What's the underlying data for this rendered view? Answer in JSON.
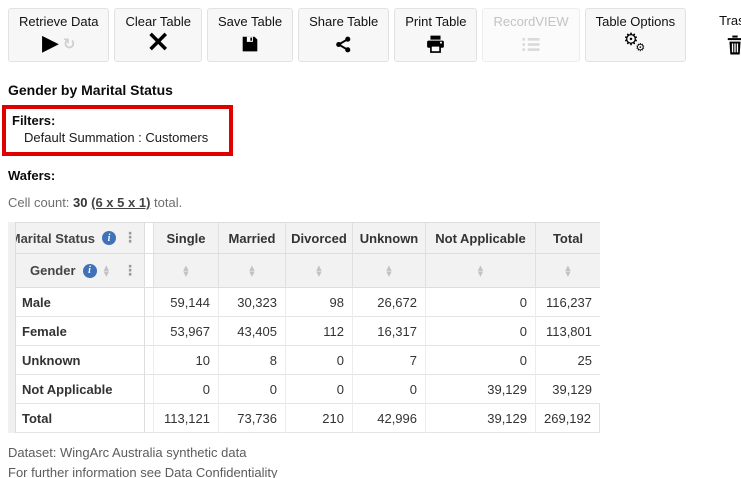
{
  "toolbar": {
    "buttons": [
      {
        "label": "Retrieve Data",
        "icon": "play-refresh-icon",
        "disabled": false
      },
      {
        "label": "Clear Table",
        "icon": "x-icon",
        "disabled": false
      },
      {
        "label": "Save Table",
        "icon": "floppy-icon",
        "disabled": false
      },
      {
        "label": "Share Table",
        "icon": "share-icon",
        "disabled": false
      },
      {
        "label": "Print Table",
        "icon": "printer-icon",
        "disabled": false
      },
      {
        "label": "RecordVIEW",
        "icon": "list-icon",
        "disabled": true
      },
      {
        "label": "Table Options",
        "icon": "gears-icon",
        "disabled": false
      },
      {
        "label": "Trash",
        "icon": "trash-icon",
        "disabled": false
      }
    ]
  },
  "page": {
    "title": "Gender by Marital Status",
    "filters_label": "Filters:",
    "filters_value": "Default Summation : Customers",
    "wafers_label": "Wafers:",
    "cell_count_prefix": "Cell count: ",
    "cell_count_value": "30",
    "cell_count_link": "(6 x 5 x 1)",
    "cell_count_suffix": " total."
  },
  "table": {
    "col_dimension": "Marital Status",
    "row_dimension": "Gender",
    "columns": [
      "Single",
      "Married",
      "Divorced",
      "Unknown",
      "Not Applicable",
      "Total"
    ],
    "rows": [
      {
        "label": "Male",
        "values": [
          "59,144",
          "30,323",
          "98",
          "26,672",
          "0",
          "116,237"
        ]
      },
      {
        "label": "Female",
        "values": [
          "53,967",
          "43,405",
          "112",
          "16,317",
          "0",
          "113,801"
        ]
      },
      {
        "label": "Unknown",
        "values": [
          "10",
          "8",
          "0",
          "7",
          "0",
          "25"
        ]
      },
      {
        "label": "Not Applicable",
        "values": [
          "0",
          "0",
          "0",
          "0",
          "39,129",
          "39,129"
        ]
      },
      {
        "label": "Total",
        "values": [
          "113,121",
          "73,736",
          "210",
          "42,996",
          "39,129",
          "269,192"
        ]
      }
    ]
  },
  "footer": {
    "dataset_line": "Dataset: WingArc Australia synthetic data",
    "info_prefix": "For further information see ",
    "info_link": "Data Confidentiality"
  },
  "colors": {
    "filter_highlight": "#e00000",
    "info_icon": "#3f72b8",
    "header_bg": "#f2f2f2",
    "border": "#dddddd"
  }
}
